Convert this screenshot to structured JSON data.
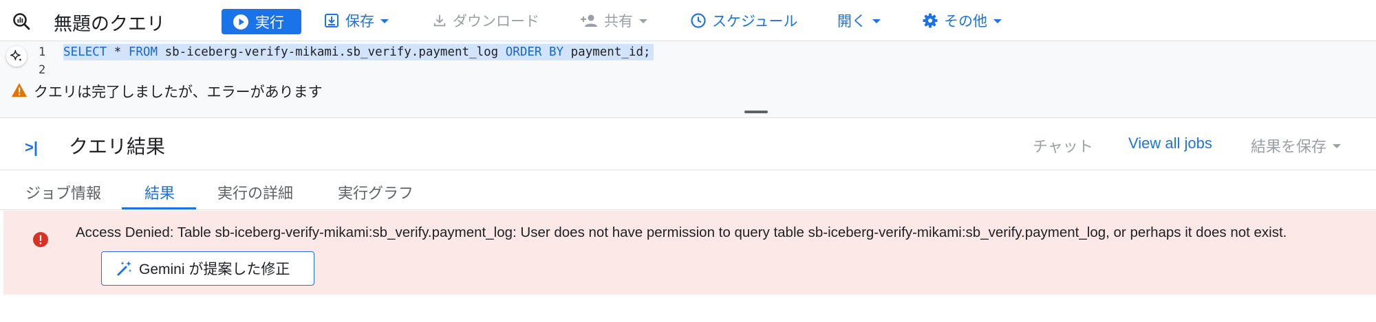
{
  "toolbar": {
    "title": "無題のクエリ",
    "run_label": "実行",
    "save_label": "保存",
    "download_label": "ダウンロード",
    "share_label": "共有",
    "schedule_label": "スケジュール",
    "open_label": "開く",
    "more_label": "その他"
  },
  "editor": {
    "line_numbers": [
      "1",
      "2"
    ],
    "tokens": {
      "select": "SELECT",
      "star": "*",
      "from": "FROM",
      "table": "sb-iceberg-verify-mikami.sb_verify.payment_log",
      "order": "ORDER",
      "by": "BY",
      "column": "payment_id;"
    }
  },
  "status": {
    "message": "クエリは完了しましたが、エラーがあります"
  },
  "results": {
    "title": "クエリ結果",
    "chat_label": "チャット",
    "view_jobs_label": "View all jobs",
    "save_results_label": "結果を保存",
    "tabs": [
      {
        "label": "ジョブ情報"
      },
      {
        "label": "結果"
      },
      {
        "label": "実行の詳細"
      },
      {
        "label": "実行グラフ"
      }
    ],
    "active_tab": 1
  },
  "error": {
    "message": "Access Denied: Table sb-iceberg-verify-mikami:sb_verify.payment_log: User does not have permission to query table sb-iceberg-verify-mikami:sb_verify.payment_log, or perhaps it does not exist.",
    "gemini_button_label": "Gemini が提案した修正"
  },
  "colors": {
    "accent": "#1a73e8",
    "error_bg": "#fce8e6",
    "error_icon": "#d93025",
    "warning": "#e37400",
    "disabled": "#9aa0a6",
    "selection": "#d2e3fc"
  }
}
